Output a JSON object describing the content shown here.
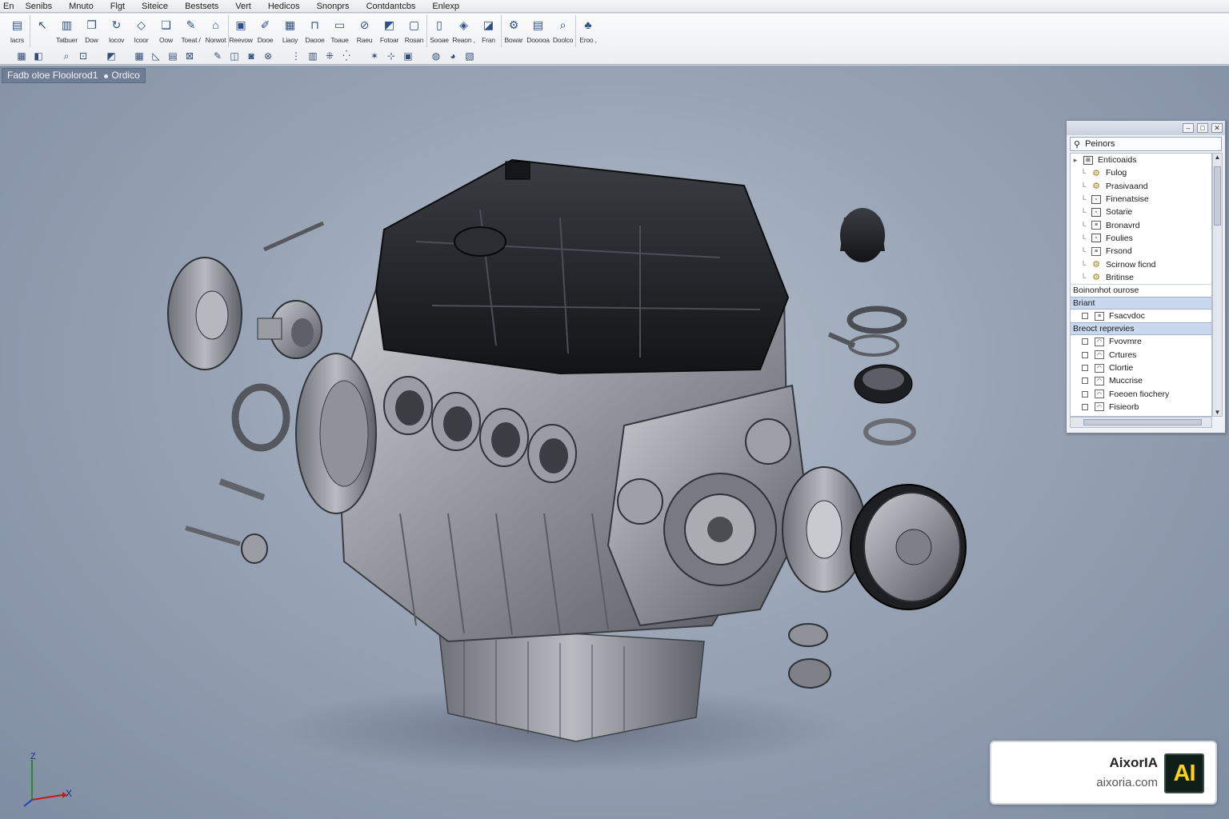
{
  "menu": [
    "En",
    "Senibs",
    "Mnuto",
    "Flgt",
    "Siteice",
    "Bestsets",
    "Vert",
    "Hedicos",
    "Snonprs",
    "Contdantcbs",
    "Enlexp"
  ],
  "toolbar": {
    "buttons": [
      {
        "label": "lacrs",
        "icon": "document-icon",
        "glyph": "▤"
      },
      {
        "label": "",
        "icon": "select-arrow-icon",
        "glyph": "↖"
      },
      {
        "label": "Tatbuer",
        "icon": "part-icon",
        "glyph": "▥"
      },
      {
        "label": "Dow",
        "icon": "copy-icon",
        "glyph": "❐"
      },
      {
        "label": "Iocov",
        "icon": "rotate-icon",
        "glyph": "↻"
      },
      {
        "label": "Icoor",
        "icon": "diamond-icon",
        "glyph": "◇"
      },
      {
        "label": "Oow",
        "icon": "assembly-icon",
        "glyph": "❏"
      },
      {
        "label": "Toeat /",
        "icon": "wrench-icon",
        "glyph": "✎"
      },
      {
        "label": "Norwot",
        "icon": "component-icon",
        "glyph": "⌂"
      },
      {
        "label": "Reevow",
        "icon": "monitor-icon",
        "glyph": "▣"
      },
      {
        "label": "Dooe",
        "icon": "edit-part-icon",
        "glyph": "✐"
      },
      {
        "label": "Liaoy",
        "icon": "pattern-icon",
        "glyph": "▦"
      },
      {
        "label": "Daooe",
        "icon": "mate-icon",
        "glyph": "⊓"
      },
      {
        "label": "Toaue",
        "icon": "sheet-icon",
        "glyph": "▭"
      },
      {
        "label": "Raeu",
        "icon": "circle-slash-icon",
        "glyph": "⊘"
      },
      {
        "label": "Fotoar",
        "icon": "folder-icon",
        "glyph": "◩"
      },
      {
        "label": "Rosan",
        "icon": "screen-icon",
        "glyph": "▢"
      },
      {
        "label": "Sooae",
        "icon": "window-icon",
        "glyph": "▯"
      },
      {
        "label": "Reaon ,",
        "icon": "explode-icon",
        "glyph": "◈"
      },
      {
        "label": "Fran",
        "icon": "tag-icon",
        "glyph": "◪"
      },
      {
        "label": "Bowar",
        "icon": "gear-icon",
        "glyph": "⚙"
      },
      {
        "label": "Dooooa",
        "icon": "drawing-icon",
        "glyph": "▤"
      },
      {
        "label": "Doolco",
        "icon": "zoom-icon",
        "glyph": "⌕"
      },
      {
        "label": "Eroo ,",
        "icon": "bike-icon",
        "glyph": "♣"
      }
    ],
    "small_buttons": [
      {
        "icon": "save-icon",
        "glyph": "▦"
      },
      {
        "icon": "open-icon",
        "glyph": "◧"
      },
      {
        "icon": "search-icon",
        "glyph": "⌕"
      },
      {
        "icon": "lock-icon",
        "glyph": "⊡"
      },
      {
        "icon": "color-icon",
        "glyph": "◩"
      },
      {
        "icon": "grid-icon",
        "glyph": "▦"
      },
      {
        "icon": "sketch-icon",
        "glyph": "◺"
      },
      {
        "icon": "doc-icon",
        "glyph": "▤"
      },
      {
        "icon": "dimension-icon",
        "glyph": "⊠"
      },
      {
        "icon": "pencil-icon",
        "glyph": "✎"
      },
      {
        "icon": "section-icon",
        "glyph": "◫"
      },
      {
        "icon": "camera-icon",
        "glyph": "◙"
      },
      {
        "icon": "stop-icon",
        "glyph": "⊗"
      },
      {
        "icon": "fit-icon",
        "glyph": "⋮"
      },
      {
        "icon": "view-icon",
        "glyph": "▥"
      },
      {
        "icon": "hide-icon",
        "glyph": "⁜"
      },
      {
        "icon": "cross-icon",
        "glyph": "⁛"
      },
      {
        "icon": "star-icon",
        "glyph": "✶"
      },
      {
        "icon": "axis-icon",
        "glyph": "⊹"
      },
      {
        "icon": "shade-icon",
        "glyph": "▣"
      },
      {
        "icon": "render-icon",
        "glyph": "◍"
      },
      {
        "icon": "appearance-icon",
        "glyph": "◕"
      },
      {
        "icon": "display-icon",
        "glyph": "▧"
      }
    ]
  },
  "document_tab": {
    "title": "Fadb oloe Floolorod1",
    "mode": "Ordico"
  },
  "triad": {
    "x_label": "X",
    "z_label": "Z"
  },
  "panel": {
    "title": "Peinors",
    "tree_root": "Enticoaids",
    "items": [
      {
        "label": "Fulog",
        "icon": "gear"
      },
      {
        "label": "Prasivaand",
        "icon": "gear"
      },
      {
        "label": "Finenatsise",
        "icon": "box"
      },
      {
        "label": "Sotarie",
        "icon": "box"
      },
      {
        "label": "Bronavrd",
        "icon": "doc"
      },
      {
        "label": "Foulies",
        "icon": "box"
      },
      {
        "label": "Frsond",
        "icon": "doc"
      },
      {
        "label": "Scirnow ficnd",
        "icon": "gear"
      },
      {
        "label": "Britinse",
        "icon": "gear"
      }
    ],
    "section1": "Boinonhot ourose",
    "section2": "Briant",
    "section2_items": [
      {
        "label": "Fsacvdoc"
      }
    ],
    "section3": "Breoct reprevies",
    "section3_items": [
      {
        "label": "Fvovmre"
      },
      {
        "label": "Crtures"
      },
      {
        "label": "Clortie"
      },
      {
        "label": "Muccrise"
      },
      {
        "label": "Foeoen fiochery"
      },
      {
        "label": "Fisieorb"
      }
    ]
  },
  "watermark": {
    "name": "AixorIA",
    "url": "aixoria.com",
    "logo_text": "AI"
  },
  "colors": {
    "viewport": "#98a4b5",
    "engine_dark": "#1f2226",
    "engine_metal": "#8a8e94",
    "watermark_logo_bg": "#0e1f1a",
    "watermark_logo_fg": "#ffd21a"
  }
}
